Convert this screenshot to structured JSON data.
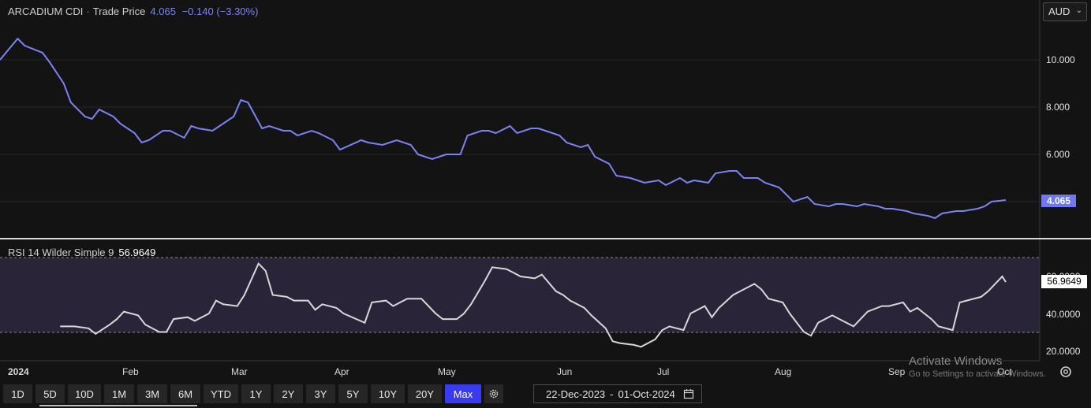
{
  "header": {
    "instrument": "ARCADIUM CDI",
    "separator": "·",
    "series_label": "Trade Price",
    "last_value": "4.065",
    "change": "−0.140 (−3.30%)"
  },
  "currency": {
    "selected": "AUD",
    "chevron_icon": "chevron-down-icon"
  },
  "price_axis_labels": [
    "10.000",
    "8.000",
    "6.000"
  ],
  "price_tag": "4.065",
  "rsi": {
    "label": "RSI 14 Wilder Simple 9",
    "value": "56.9649",
    "axis_labels": [
      "60.0000",
      "40.0000",
      "20.0000"
    ],
    "tag": "56.9649"
  },
  "x_axis_labels": [
    "2024",
    "Feb",
    "Mar",
    "Apr",
    "May",
    "Jun",
    "Jul",
    "Aug",
    "Sep",
    "Oct"
  ],
  "range_buttons": [
    "1D",
    "5D",
    "10D",
    "1M",
    "3M",
    "6M",
    "YTD",
    "1Y",
    "2Y",
    "3Y",
    "5Y",
    "10Y",
    "20Y",
    "Max"
  ],
  "active_range": "Max",
  "date_range": {
    "start": "22-Dec-2023",
    "separator": "-",
    "end": "01-Oct-2024"
  },
  "watermark": {
    "title": "Activate Windows",
    "subtitle": "Go to Settings to activate Windows."
  },
  "colors": {
    "price_line": "#7b83f4",
    "rsi_line": "#d8d8d8",
    "rsi_band": "#2a2438",
    "active_button": "#3a3af0"
  },
  "chart_data": [
    {
      "type": "line",
      "title": "ARCADIUM CDI · Trade Price",
      "ylim": [
        3.0,
        11.5
      ],
      "x": [
        "2023-12-22",
        "2023-12-27",
        "2023-12-29",
        "2024-01-03",
        "2024-01-05",
        "2024-01-09",
        "2024-01-11",
        "2024-01-15",
        "2024-01-17",
        "2024-01-19",
        "2024-01-23",
        "2024-01-25",
        "2024-01-29",
        "2024-01-31",
        "2024-02-02",
        "2024-02-06",
        "2024-02-08",
        "2024-02-12",
        "2024-02-14",
        "2024-02-16",
        "2024-02-20",
        "2024-02-22",
        "2024-02-26",
        "2024-02-28",
        "2024-03-01",
        "2024-03-05",
        "2024-03-07",
        "2024-03-11",
        "2024-03-13",
        "2024-03-15",
        "2024-03-19",
        "2024-03-21",
        "2024-03-25",
        "2024-03-27",
        "2024-04-02",
        "2024-04-04",
        "2024-04-08",
        "2024-04-10",
        "2024-04-12",
        "2024-04-16",
        "2024-04-18",
        "2024-04-22",
        "2024-04-24",
        "2024-04-26",
        "2024-04-30",
        "2024-05-02",
        "2024-05-06",
        "2024-05-08",
        "2024-05-10",
        "2024-05-14",
        "2024-05-16",
        "2024-05-20",
        "2024-05-22",
        "2024-05-24",
        "2024-05-28",
        "2024-05-30",
        "2024-06-03",
        "2024-06-05",
        "2024-06-07",
        "2024-06-11",
        "2024-06-13",
        "2024-06-17",
        "2024-06-19",
        "2024-06-21",
        "2024-06-25",
        "2024-06-27",
        "2024-07-01",
        "2024-07-03",
        "2024-07-05",
        "2024-07-09",
        "2024-07-11",
        "2024-07-15",
        "2024-07-17",
        "2024-07-19",
        "2024-07-23",
        "2024-07-25",
        "2024-07-29",
        "2024-07-31",
        "2024-08-02",
        "2024-08-06",
        "2024-08-08",
        "2024-08-12",
        "2024-08-14",
        "2024-08-16",
        "2024-08-20",
        "2024-08-22",
        "2024-08-26",
        "2024-08-28",
        "2024-08-30",
        "2024-09-03",
        "2024-09-05",
        "2024-09-09",
        "2024-09-11",
        "2024-09-13",
        "2024-09-17",
        "2024-09-19",
        "2024-09-23",
        "2024-09-25",
        "2024-09-27",
        "2024-10-01"
      ],
      "series": [
        {
          "values": [
            10.0,
            10.9,
            10.6,
            10.3,
            9.9,
            9.0,
            8.2,
            7.6,
            7.5,
            7.9,
            7.6,
            7.3,
            6.9,
            6.5,
            6.6,
            7.0,
            7.0,
            6.7,
            7.2,
            7.1,
            7.0,
            7.2,
            7.6,
            8.3,
            8.2,
            7.1,
            7.2,
            7.0,
            7.0,
            6.8,
            7.0,
            6.9,
            6.6,
            6.2,
            6.6,
            6.5,
            6.4,
            6.5,
            6.6,
            6.4,
            6.0,
            5.8,
            5.9,
            6.0,
            6.0,
            6.8,
            7.0,
            7.0,
            6.9,
            7.2,
            6.9,
            7.1,
            7.1,
            7.0,
            6.8,
            6.5,
            6.3,
            6.4,
            5.9,
            5.6,
            5.1,
            5.0,
            4.9,
            4.8,
            4.9,
            4.7,
            5.0,
            4.8,
            4.9,
            4.8,
            5.2,
            5.3,
            5.3,
            5.0,
            5.0,
            4.8,
            4.6,
            4.3,
            4.0,
            4.2,
            3.9,
            3.8,
            3.9,
            3.9,
            3.8,
            3.9,
            3.8,
            3.7,
            3.7,
            3.6,
            3.5,
            3.4,
            3.3,
            3.5,
            3.6,
            3.6,
            3.7,
            3.8,
            4.0,
            4.065
          ]
        }
      ]
    },
    {
      "type": "line",
      "title": "RSI 14 Wilder Simple 9",
      "ylim": [
        14,
        71
      ],
      "x": [
        "2024-01-08",
        "2024-01-12",
        "2024-01-16",
        "2024-01-18",
        "2024-01-22",
        "2024-01-24",
        "2024-01-26",
        "2024-01-30",
        "2024-02-01",
        "2024-02-05",
        "2024-02-07",
        "2024-02-09",
        "2024-02-13",
        "2024-02-15",
        "2024-02-19",
        "2024-02-21",
        "2024-02-23",
        "2024-02-27",
        "2024-02-29",
        "2024-03-04",
        "2024-03-06",
        "2024-03-08",
        "2024-03-12",
        "2024-03-14",
        "2024-03-18",
        "2024-03-20",
        "2024-03-22",
        "2024-03-26",
        "2024-03-28",
        "2024-04-03",
        "2024-04-05",
        "2024-04-09",
        "2024-04-11",
        "2024-04-15",
        "2024-04-17",
        "2024-04-19",
        "2024-04-23",
        "2024-04-25",
        "2024-04-29",
        "2024-05-01",
        "2024-05-03",
        "2024-05-07",
        "2024-05-09",
        "2024-05-13",
        "2024-05-15",
        "2024-05-17",
        "2024-05-21",
        "2024-05-23",
        "2024-05-27",
        "2024-05-29",
        "2024-05-31",
        "2024-06-04",
        "2024-06-06",
        "2024-06-10",
        "2024-06-12",
        "2024-06-14",
        "2024-06-18",
        "2024-06-20",
        "2024-06-24",
        "2024-06-26",
        "2024-06-28",
        "2024-07-02",
        "2024-07-04",
        "2024-07-08",
        "2024-07-10",
        "2024-07-12",
        "2024-07-16",
        "2024-07-18",
        "2024-07-22",
        "2024-07-24",
        "2024-07-26",
        "2024-07-30",
        "2024-08-01",
        "2024-08-05",
        "2024-08-07",
        "2024-08-09",
        "2024-08-13",
        "2024-08-15",
        "2024-08-19",
        "2024-08-21",
        "2024-08-23",
        "2024-08-27",
        "2024-08-29",
        "2024-09-02",
        "2024-09-04",
        "2024-09-06",
        "2024-09-10",
        "2024-09-12",
        "2024-09-16",
        "2024-09-18",
        "2024-09-20",
        "2024-09-24",
        "2024-09-26",
        "2024-09-30",
        "2024-10-01"
      ],
      "series": [
        {
          "values": [
            33,
            33,
            32,
            29,
            34,
            37,
            41,
            39,
            34,
            30,
            30,
            37,
            38,
            36,
            40,
            47,
            45,
            44,
            50,
            67,
            63,
            50,
            49,
            47,
            47,
            42,
            45,
            43,
            40,
            35,
            46,
            47,
            44,
            48,
            48,
            48,
            40,
            37,
            37,
            40,
            45,
            58,
            65,
            64,
            62,
            60,
            59,
            61,
            52,
            50,
            47,
            43,
            39,
            32,
            25,
            24,
            23,
            22,
            26,
            31,
            33,
            31,
            40,
            44,
            38,
            43,
            50,
            52,
            56,
            53,
            48,
            46,
            40,
            30,
            28,
            35,
            39,
            37,
            33,
            37,
            41,
            44,
            44,
            46,
            41,
            43,
            37,
            33,
            31,
            46,
            47,
            49,
            52,
            60,
            56.96
          ]
        }
      ]
    }
  ]
}
